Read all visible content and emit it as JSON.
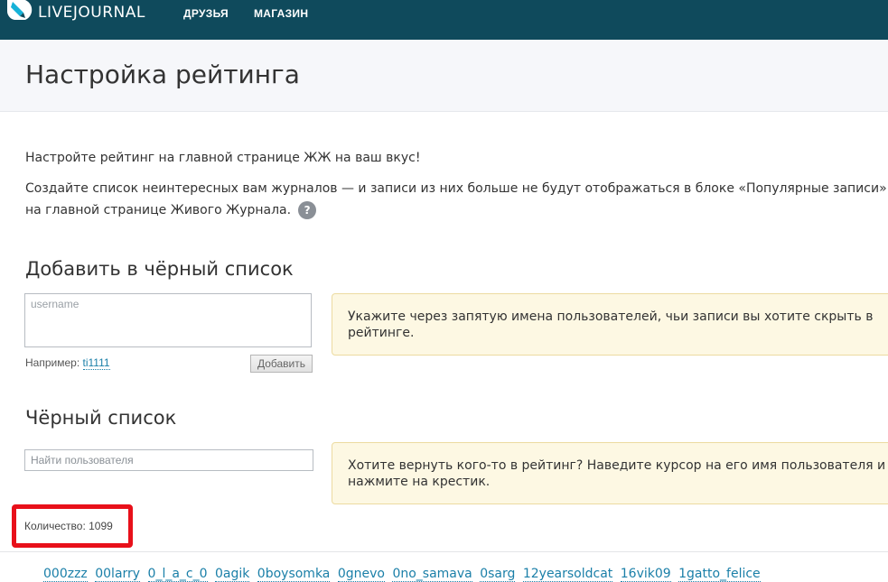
{
  "header": {
    "logo_text": "LIVEJOURNAL",
    "nav": [
      "ДРУЗЬЯ",
      "МАГАЗИН"
    ]
  },
  "page": {
    "title": "Настройка рейтинга",
    "intro_line1": "Настройте рейтинг на главной странице ЖЖ на ваш вкус!",
    "intro_line2a": "Создайте список неинтересных вам журналов — и записи из них больше не будут отображаться в блоке «Популярные записи»",
    "intro_line2b": "на главной странице Живого Журнала.",
    "help_icon_label": "?"
  },
  "add_section": {
    "title": "Добавить в чёрный список",
    "username_placeholder": "username",
    "example_label": "Например:",
    "example_user": "ti1111",
    "add_button": "Добавить",
    "hint": "Укажите через запятую имена пользователей, чьи записи вы хотите скрыть в рейтинге."
  },
  "blacklist": {
    "title": "Чёрный список",
    "search_placeholder": "Найти пользователя",
    "hint": "Хотите вернуть кого-то в рейтинг? Наведите курсор на его имя пользователя и нажмите на крестик.",
    "count_label": "Количество: 1099",
    "users": [
      "000zzz",
      "00larry",
      "0_l_a_c_0",
      "0agik",
      "0boysomka",
      "0gnevo",
      "0no_samava",
      "0sarg",
      "12yearsoldcat",
      "16vik09",
      "1gatto_felice"
    ]
  },
  "colors": {
    "header_bg": "#0f4a5c",
    "highlight_border": "#e8101a",
    "link": "#1a7fa8",
    "hint_bg": "#fdf8e3"
  }
}
